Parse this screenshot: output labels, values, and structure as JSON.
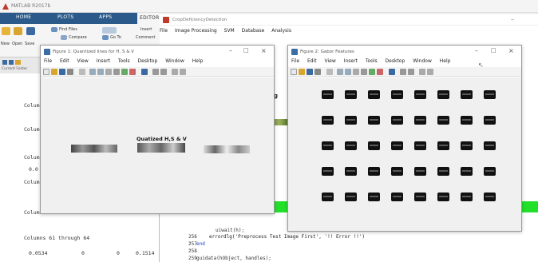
{
  "app": {
    "title": "MATLAB R2017b"
  },
  "ribbon_tabs": [
    {
      "label": "HOME"
    },
    {
      "label": "PLOTS"
    },
    {
      "label": "APPS"
    },
    {
      "label": "EDITOR"
    }
  ],
  "ribbon": {
    "find_files": "Find Files",
    "compare": "Compare",
    "go_to": "Go To",
    "new": "New",
    "open": "Open",
    "save": "Save",
    "insert": "Insert",
    "comment": "Comment"
  },
  "address": {
    "current_folder": "Current Folder"
  },
  "command_window": {
    "lines": [
      "Colum",
      "Colum",
      "Colum",
      "0.0",
      "Colum",
      "Colum"
    ],
    "footer_heading": "Columns 61 through 64",
    "footer_values": [
      "0.0534",
      "0",
      "0",
      "0.1514"
    ]
  },
  "editor": {
    "title": "CropDeficiencyDetection",
    "menu": [
      "File",
      "Image Processing",
      "SVM",
      "Database",
      "Analysis"
    ],
    "line_numbers": [
      "256 -",
      "257 -",
      "258",
      "259 -"
    ],
    "code_lines": [
      "uiwait(h);",
      "errordlg('Preprocess Test Image First', '!! Error !!')",
      "end",
      "guidata(hObject, handles);"
    ],
    "partial_code_top": "g"
  },
  "figure1": {
    "title": "Figure 1: Quantized lines for H, S & V",
    "menu": [
      "File",
      "Edit",
      "View",
      "Insert",
      "Tools",
      "Desktop",
      "Window",
      "Help"
    ],
    "plot_title": "Quatized H,S & V"
  },
  "figure2": {
    "title": "Figure 2: Gabor Features",
    "menu": [
      "File",
      "Edit",
      "View",
      "Insert",
      "Tools",
      "Desktop",
      "Window",
      "Help"
    ]
  },
  "gabor": {
    "rows": 5,
    "cols": 8
  },
  "colors": {
    "accent": "#2b5a8a",
    "status_green": "#22e02a"
  }
}
